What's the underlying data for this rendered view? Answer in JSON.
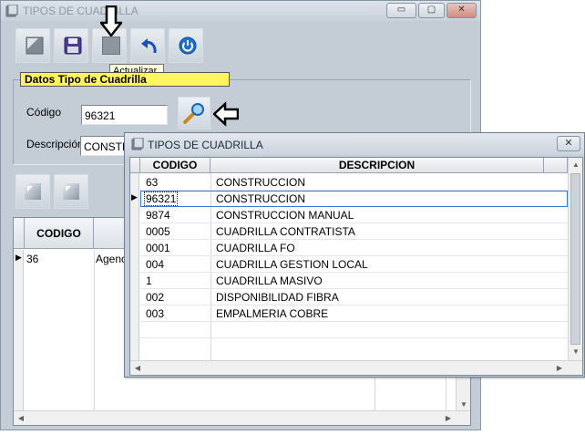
{
  "main_window": {
    "title": "TIPOS DE CUADRILLA",
    "controls": {
      "minimize": "▭",
      "maximize": "▢",
      "close": "✕"
    }
  },
  "toolbar": {
    "buttons": [
      "new-doc-icon",
      "save-icon",
      "update-icon",
      "undo-icon",
      "power-icon"
    ],
    "tooltip": "Actualizar"
  },
  "form": {
    "group_title": "Datos Tipo de Cuadrilla",
    "codigo_label": "Código",
    "codigo_value": "96321",
    "descripcion_label": "Descripción",
    "descripcion_value": "CONSTRUCCION"
  },
  "main_grid": {
    "columns": [
      "CODIGO",
      ""
    ],
    "rows": [
      {
        "codigo": "36",
        "descripcion": "Agencia"
      }
    ]
  },
  "popup": {
    "title": "TIPOS DE CUADRILLA",
    "close": "✕",
    "columns": [
      "CODIGO",
      "DESCRIPCION"
    ],
    "rows": [
      {
        "codigo": "63",
        "descripcion": "CONSTRUCCION"
      },
      {
        "codigo": "96321",
        "descripcion": "CONSTRUCCION"
      },
      {
        "codigo": "9874",
        "descripcion": "CONSTRUCCION MANUAL"
      },
      {
        "codigo": "0005",
        "descripcion": "CUADRILLA CONTRATISTA"
      },
      {
        "codigo": "0001",
        "descripcion": "CUADRILLA FO"
      },
      {
        "codigo": "004",
        "descripcion": "CUADRILLA GESTION LOCAL"
      },
      {
        "codigo": "1",
        "descripcion": "CUADRILLA MASIVO"
      },
      {
        "codigo": "002",
        "descripcion": "DISPONIBILIDAD FIBRA"
      },
      {
        "codigo": "003",
        "descripcion": "EMPALMERIA COBRE"
      }
    ],
    "selected_row": 1
  },
  "colors": {
    "window_bg": "#c4ccd6",
    "group_title_bg": "#fff55f",
    "tooltip_bg": "#ffffe1",
    "selection_outline": "#3a78d6"
  }
}
